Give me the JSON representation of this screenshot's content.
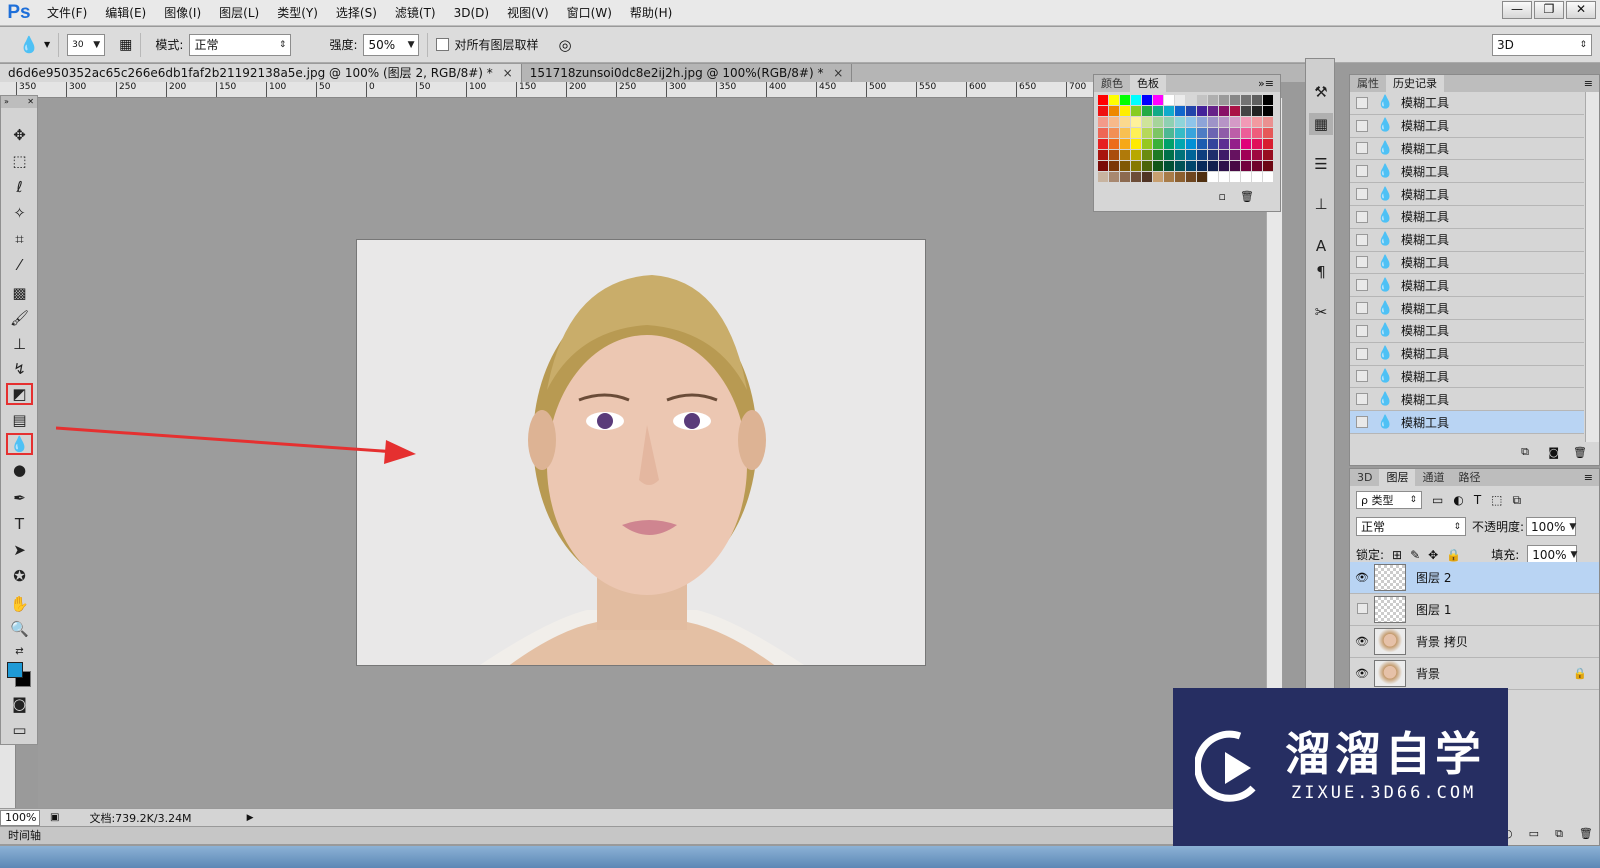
{
  "app": {
    "logo": "Ps"
  },
  "menu": [
    "文件(F)",
    "编辑(E)",
    "图像(I)",
    "图层(L)",
    "类型(Y)",
    "选择(S)",
    "滤镜(T)",
    "3D(D)",
    "视图(V)",
    "窗口(W)",
    "帮助(H)"
  ],
  "window_controls": [
    "—",
    "❐",
    "✕"
  ],
  "options": {
    "brush_size": "30",
    "mode_label": "模式:",
    "mode_value": "正常",
    "strength_label": "强度:",
    "strength_value": "50%",
    "sample_all_label": "对所有图层取样",
    "workspace": "3D"
  },
  "tabs": [
    {
      "title": "d6d6e950352ac65c266e6db1faf2b21192138a5e.jpg @ 100% (图层 2, RGB/8#) *",
      "close": "×"
    },
    {
      "title": "151718zunsoi0dc8e2ij2h.jpg @ 100%(RGB/8#) *",
      "close": "×"
    }
  ],
  "ruler_labels": [
    "350",
    "300",
    "250",
    "200",
    "150",
    "100",
    "50",
    "0",
    "50",
    "100",
    "150",
    "200",
    "250",
    "300",
    "350",
    "400",
    "450",
    "500",
    "550",
    "600",
    "650",
    "700"
  ],
  "status": {
    "zoom": "100%",
    "doc_info": "文档:739.2K/3.24M"
  },
  "timeline_label": "时间轴",
  "swatches_panel": {
    "tabs": [
      "颜色",
      "色板"
    ]
  },
  "history_panel": {
    "tabs": [
      "属性",
      "历史记录"
    ],
    "items": [
      "模糊工具",
      "模糊工具",
      "模糊工具",
      "模糊工具",
      "模糊工具",
      "模糊工具",
      "模糊工具",
      "模糊工具",
      "模糊工具",
      "模糊工具",
      "模糊工具",
      "模糊工具",
      "模糊工具",
      "模糊工具",
      "模糊工具"
    ]
  },
  "layers_panel": {
    "tabs": [
      "3D",
      "图层",
      "通道",
      "路径"
    ],
    "filter_label": "ρ 类型",
    "blend_mode": "正常",
    "opacity_label": "不透明度:",
    "opacity_value": "100%",
    "lock_label": "锁定:",
    "fill_label": "填充:",
    "fill_value": "100%",
    "layers": [
      {
        "name": "图层 2",
        "visible": true,
        "selected": true
      },
      {
        "name": "图层 1",
        "visible": false,
        "selected": false
      },
      {
        "name": "背景 拷贝",
        "visible": true,
        "selected": false
      },
      {
        "name": "背景",
        "visible": true,
        "selected": false
      }
    ]
  },
  "watermark": {
    "title": "溜溜自学",
    "url": "ZIXUE.3D66.COM"
  },
  "colors": {
    "accent": "#e53030",
    "selection": "#b9d4f3",
    "foreground": "#1e9ad6",
    "background": "#000000"
  }
}
